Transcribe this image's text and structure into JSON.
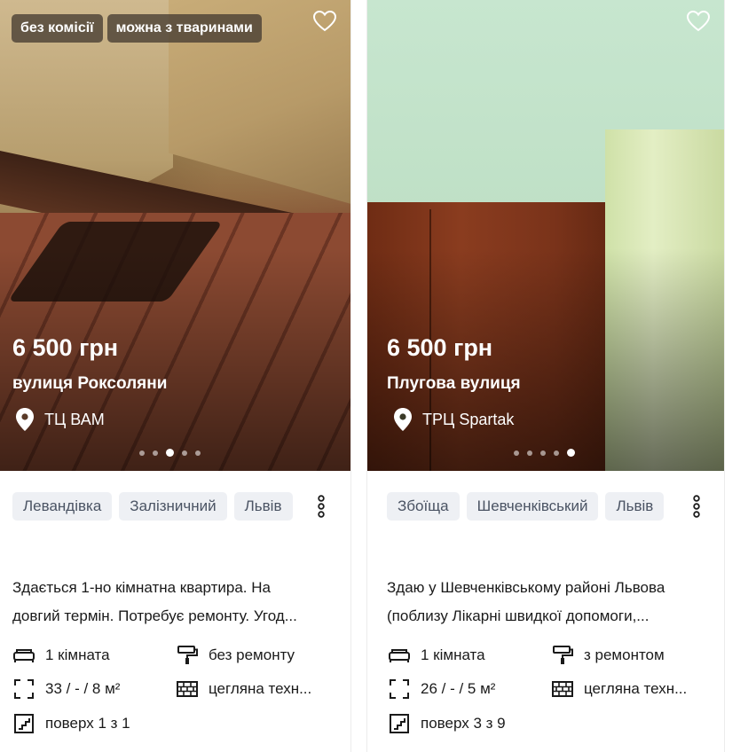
{
  "listings": [
    {
      "badges": [
        "без комісії",
        "можна з тваринами"
      ],
      "price": "6 500 грн",
      "street": "вулиця Роксоляни",
      "landmark": "ТЦ ВАМ",
      "carousel": {
        "total": 5,
        "active": 3
      },
      "tags": [
        "Левандівка",
        "Залізничний",
        "Львів"
      ],
      "description": [
        "Здається 1-но кімнатна квартира. На",
        "довгий термін. Потребує ремонту. Угод..."
      ],
      "features": {
        "rooms": "1 кімната",
        "renovation": "без ремонту",
        "area": "33 / - / 8 м²",
        "building": "цегляна техн...",
        "floor": "поверх 1 з 1"
      }
    },
    {
      "badges": [],
      "price": "6 500 грн",
      "street": "Плугова вулиця",
      "landmark": "ТРЦ Spartak",
      "carousel": {
        "total": 5,
        "active": 5
      },
      "tags": [
        "Збоїща",
        "Шевченківський",
        "Львів"
      ],
      "description": [
        "Здаю у Шевченківському районі Львова",
        "(поблизу Лікарні швидкої допомоги,..."
      ],
      "features": {
        "rooms": "1 кімната",
        "renovation": "з ремонтом",
        "area": "26 / - / 5 м²",
        "building": "цегляна техн...",
        "floor": "поверх 3 з 9"
      }
    }
  ],
  "icons": {
    "favorite": "heart-outline-icon",
    "location": "map-pin-icon",
    "more": "vertical-dots-icon",
    "rooms": "bed-icon",
    "renovation": "paint-roller-icon",
    "area": "expand-corners-icon",
    "building": "brick-wall-icon",
    "floor": "stairs-icon"
  },
  "colors": {
    "tag_bg": "#eef0f4",
    "tag_text": "#4a5363",
    "badge_bg": "#463c32"
  }
}
